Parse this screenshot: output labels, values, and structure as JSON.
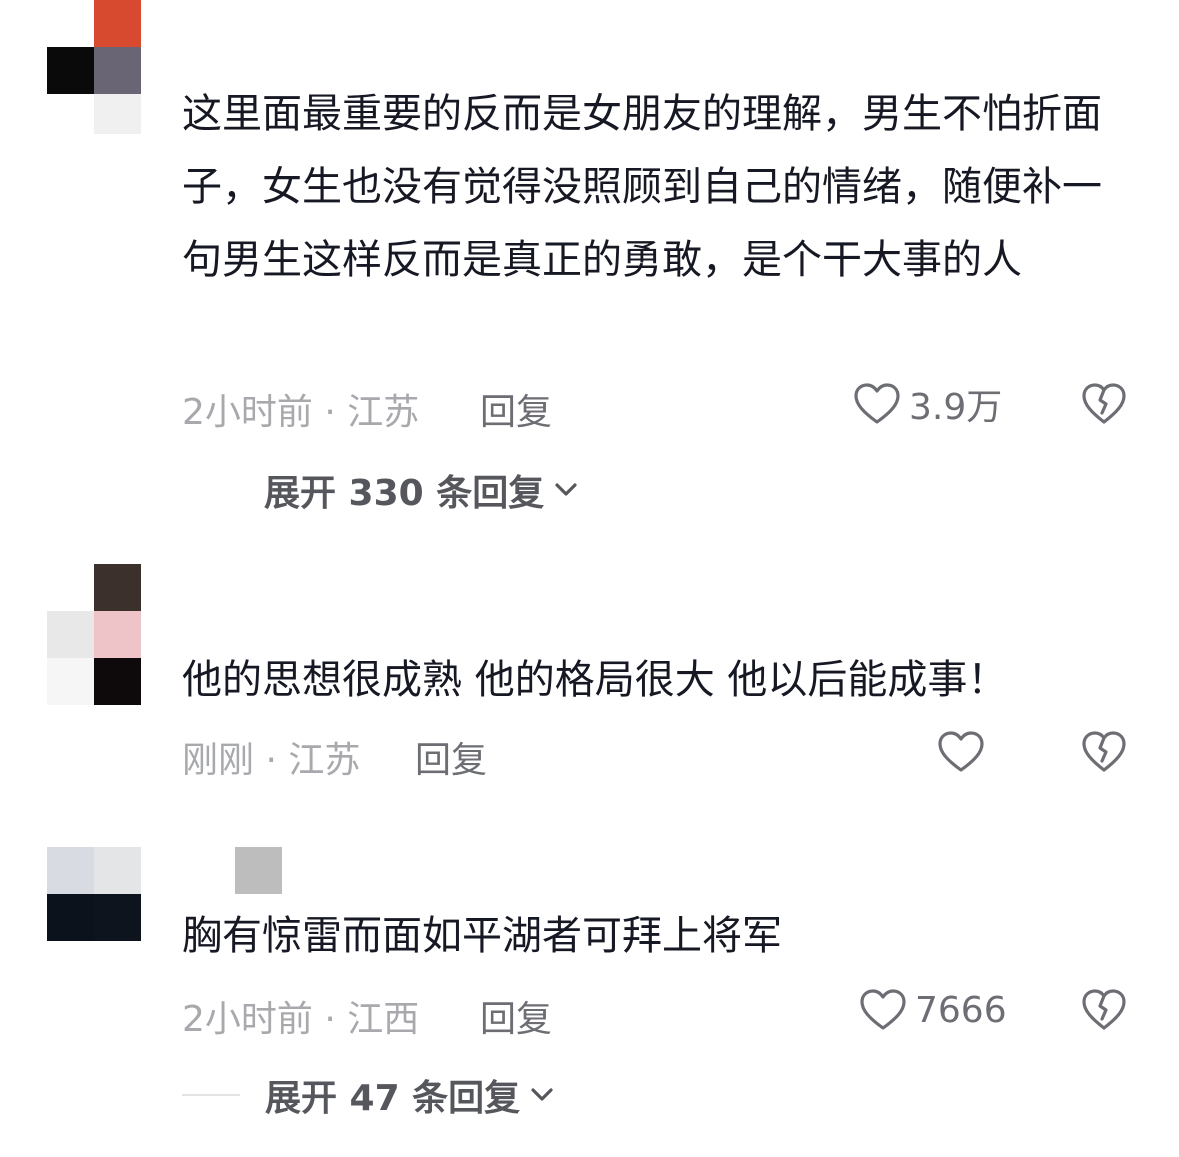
{
  "comments": [
    {
      "text": "这里面最重要的反而是女朋友的理解，男生不怕折面子，女生也没有觉得没照顾到自己的情绪，随便补一句男生这样反而是真正的勇敢，是个干大事的人",
      "meta": "2小时前 · 江苏",
      "reply_label": "回复",
      "likes": "3.9万",
      "expand_label": "展开 330 条回复",
      "avatar_colors": [
        "#d84a2f",
        "#0a0a0a",
        "#6a6574",
        "#171717"
      ]
    },
    {
      "text": "他的思想很成熟 他的格局很大 他以后能成事！",
      "meta": "刚刚 · 江苏",
      "reply_label": "回复",
      "likes": "",
      "avatar_colors": [
        "#3c302c",
        "#e8e8e8",
        "#efc4c8",
        "#f6f6f6",
        "#0e0a0b"
      ]
    },
    {
      "text": "胸有惊雷而面如平湖者可拜上将军",
      "meta": "2小时前 · 江西",
      "reply_label": "回复",
      "likes": "7666",
      "expand_label": "展开 47 条回复",
      "avatar_colors": [
        "#d8dbe2",
        "#e4e5e6",
        "#0c121b",
        "#0e141d"
      ],
      "name_placeholder_color": "#bdbdbd"
    }
  ],
  "icons": {
    "like": "heart-outline-icon",
    "dislike": "broken-heart-icon",
    "expand": "chevron-down-icon"
  },
  "colors": {
    "text": "#161823",
    "meta": "#a8a9ad",
    "action": "#6c6e74"
  }
}
